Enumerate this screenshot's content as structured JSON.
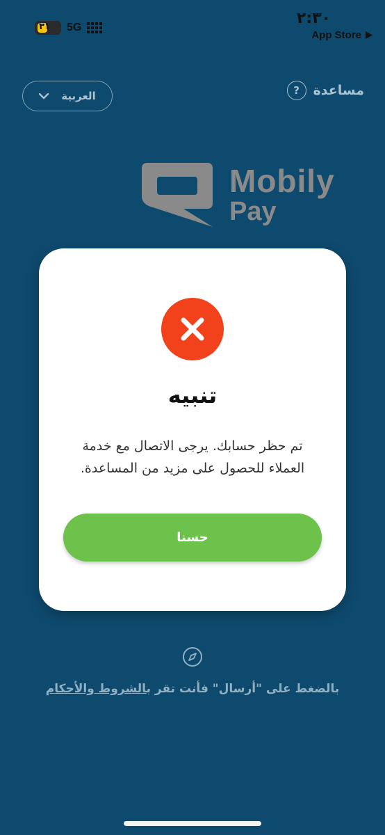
{
  "status_bar": {
    "time": "٢:٣٠",
    "back_label": "App Store",
    "back_icon": "play-arrow-icon",
    "battery": "٣١",
    "network": "5G"
  },
  "header": {
    "language_label": "العربية",
    "language_icon": "chevron-down-icon",
    "help_label": "مساعدة",
    "help_icon": "question-circle-icon"
  },
  "logo": {
    "brand_line1": "Mobily",
    "brand_line2": "Pay",
    "color": "#8a8a8a"
  },
  "dialog": {
    "icon": "close-circle-icon",
    "icon_color": "#f2421b",
    "title": "تنبيه",
    "message": "تم حظر حسابك. يرجى الاتصال مع خدمة العملاء للحصول على مزيد من المساعدة.",
    "ok_label": "حسنا",
    "ok_color": "#6cc24a"
  },
  "footer": {
    "compass_icon": "compass-icon",
    "terms_prefix": "بالضغط على \"أرسال\" فأنت تقر ب",
    "terms_link": "الشروط والأحكام"
  },
  "colors": {
    "background": "#0e4a6e",
    "dialog_background": "#ffffff"
  }
}
